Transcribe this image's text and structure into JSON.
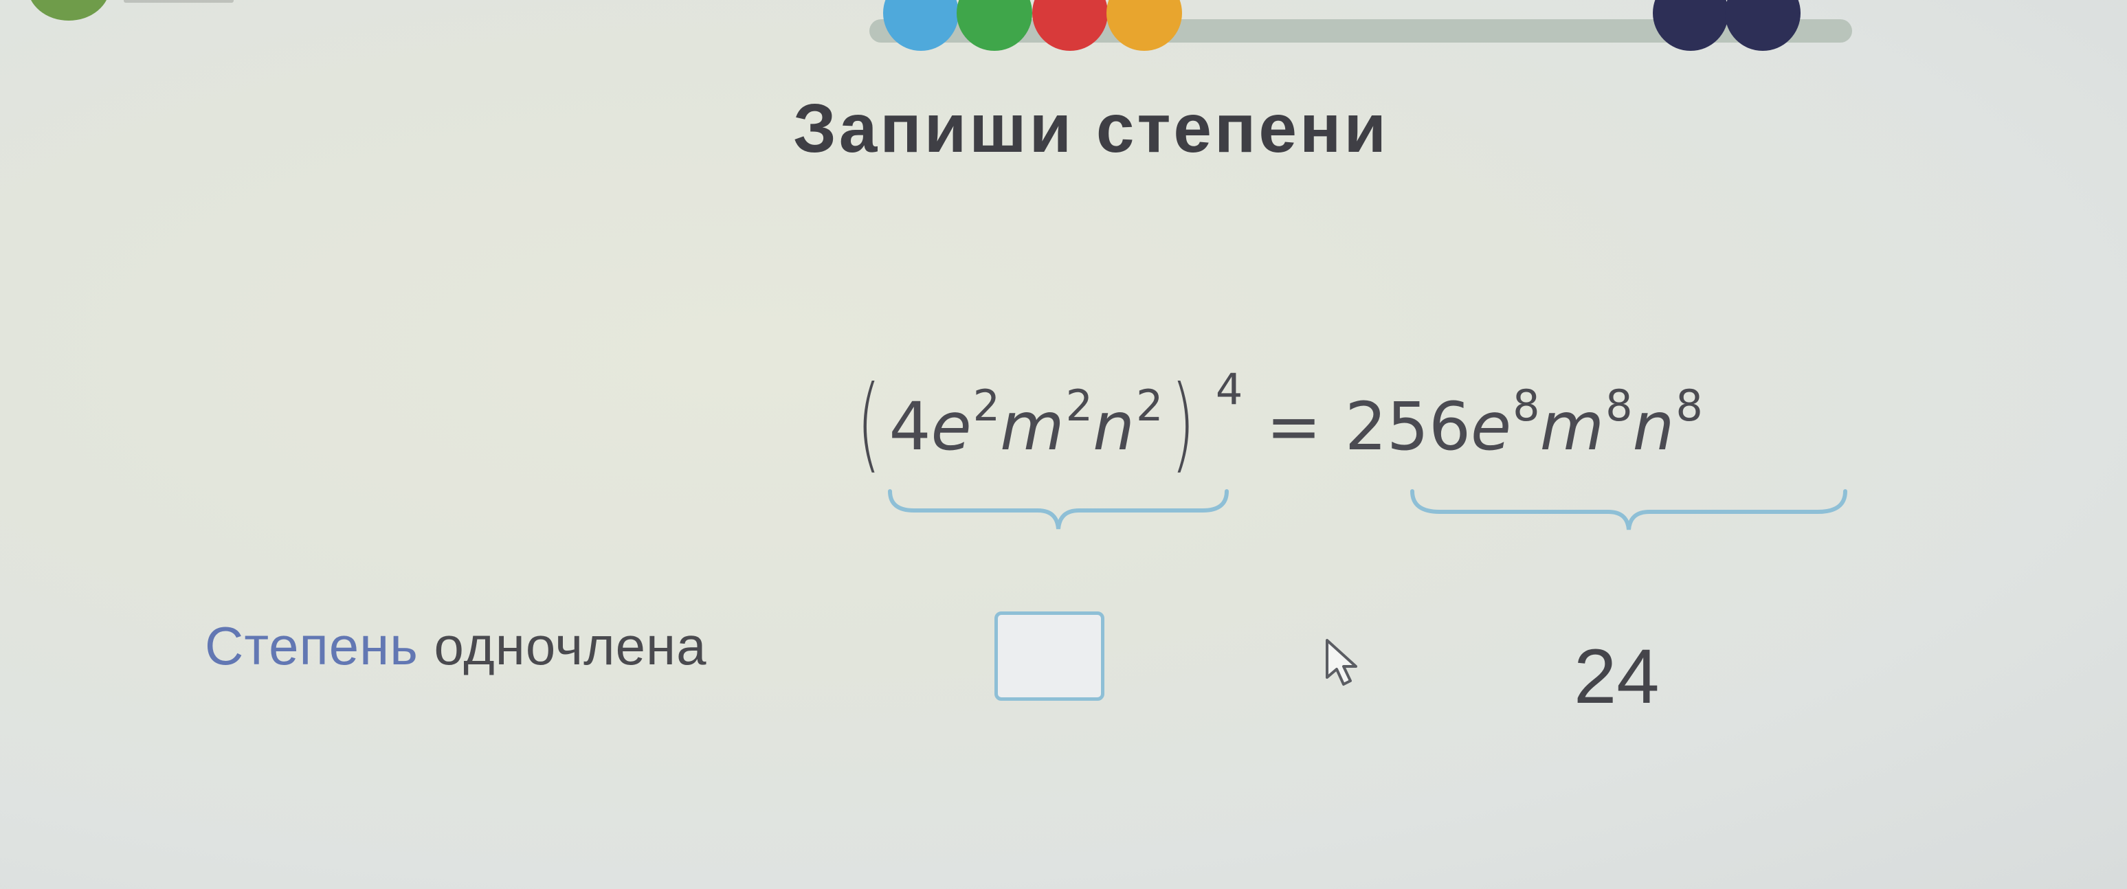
{
  "header": {
    "progress_dots": [
      {
        "name": "blue",
        "color": "#4fa9db"
      },
      {
        "name": "green",
        "color": "#3fa64a"
      },
      {
        "name": "red",
        "color": "#d83a3a"
      },
      {
        "name": "orange",
        "color": "#e8a52e"
      },
      {
        "name": "navy-1",
        "color": "#2d2f56"
      },
      {
        "name": "navy-2",
        "color": "#2d2f56"
      }
    ],
    "progress_track_color": "#b9c4bb"
  },
  "task": {
    "title": "Запиши степени",
    "formula": {
      "lhs_coefficient": "4",
      "lhs_terms": [
        {
          "var": "e",
          "exp": "2"
        },
        {
          "var": "m",
          "exp": "2"
        },
        {
          "var": "n",
          "exp": "2"
        }
      ],
      "outer_exponent": "4",
      "equals": "=",
      "rhs_coefficient": "256",
      "rhs_terms": [
        {
          "var": "e",
          "exp": "8"
        },
        {
          "var": "m",
          "exp": "8"
        },
        {
          "var": "n",
          "exp": "8"
        }
      ]
    },
    "row_label_part1": "Степень",
    "row_label_part2": " одночлена",
    "answer_input_value": "",
    "rhs_degree": "24"
  },
  "colors": {
    "brace": "#8ebfd6",
    "label_accent": "#6277b3"
  }
}
